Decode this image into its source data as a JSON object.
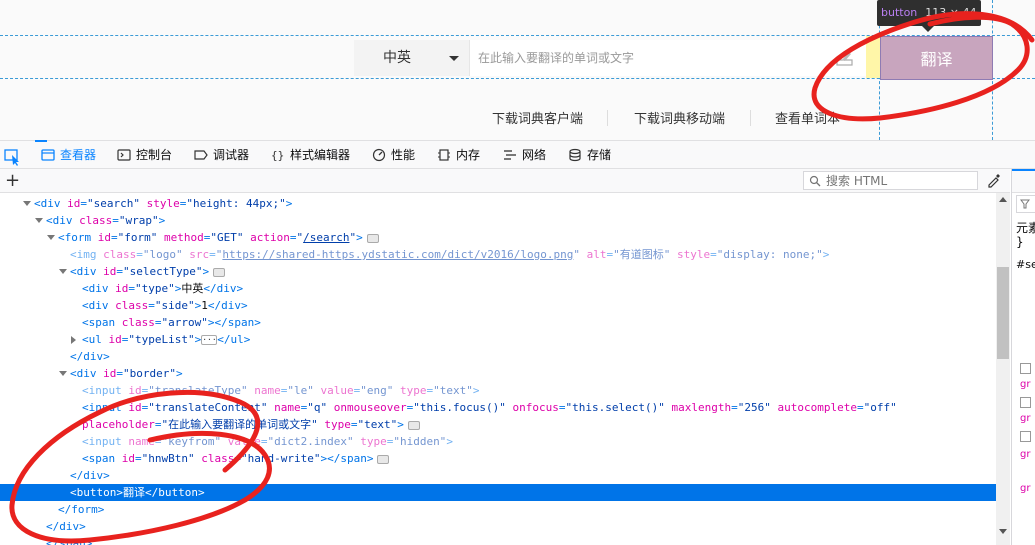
{
  "page": {
    "select_type_label": "中英",
    "search_placeholder": "在此输入要翻译的单词或文字",
    "translate_button_label": "翻译",
    "tooltip_tag": "button",
    "tooltip_dims": "113 × 44",
    "links": [
      "下载词典客户端",
      "下载词典移动端",
      "查看单词本"
    ]
  },
  "devtools": {
    "tabs": [
      {
        "label": "查看器",
        "icon": "inspector-icon",
        "active": true
      },
      {
        "label": "控制台",
        "icon": "console-icon",
        "active": false
      },
      {
        "label": "调试器",
        "icon": "debugger-icon",
        "active": false
      },
      {
        "label": "样式编辑器",
        "icon": "style-editor-icon",
        "active": false
      },
      {
        "label": "性能",
        "icon": "performance-icon",
        "active": false
      },
      {
        "label": "内存",
        "icon": "memory-icon",
        "active": false
      },
      {
        "label": "网络",
        "icon": "network-icon",
        "active": false
      },
      {
        "label": "存储",
        "icon": "storage-icon",
        "active": false
      }
    ],
    "search_html_placeholder": "搜索 HTML",
    "rules_panel": {
      "element_label": "元素",
      "brace": "}",
      "selector": "#se"
    }
  },
  "markup_lines": [
    {
      "indent": 0,
      "twisty": "open",
      "html": "<span class='tg'>&lt;div</span> <span class='an'>id</span>=<span class='av'>\"search\"</span> <span class='an'>style</span>=<span class='av'>\"height: 44px;\"</span><span class='tg'>&gt;</span>"
    },
    {
      "indent": 1,
      "twisty": "open",
      "html": "<span class='tg'>&lt;div</span> <span class='an'>class</span>=<span class='av'>\"wrap\"</span><span class='tg'>&gt;</span>"
    },
    {
      "indent": 2,
      "twisty": "open",
      "html": "<span class='tg'>&lt;form</span> <span class='an'>id</span>=<span class='av'>\"form\"</span> <span class='an'>method</span>=<span class='av'>\"GET\"</span> <span class='an'>action</span>=<span class='av'>\"<span class='url'>/search</span>\"</span><span class='tg'>&gt;</span><span class='ev'></span>"
    },
    {
      "indent": 3,
      "twisty": "none",
      "dim": true,
      "html": "<span class='tg'>&lt;img</span> <span class='an'>class</span>=<span class='av'>\"logo\"</span> <span class='an'>src</span>=<span class='av'>\"<span class='url'>https://shared-https.ydstatic.com/dict/v2016/logo.png</span>\"</span> <span class='an'>alt</span>=<span class='av'>\"有道图标\"</span> <span class='an'>style</span>=<span class='av'>\"display: none;\"</span><span class='tg'>&gt;</span>"
    },
    {
      "indent": 3,
      "twisty": "open",
      "html": "<span class='tg'>&lt;div</span> <span class='an'>id</span>=<span class='av'>\"selectType\"</span><span class='tg'>&gt;</span><span class='ev'></span>"
    },
    {
      "indent": 4,
      "twisty": "none",
      "html": "<span class='tg'>&lt;div</span> <span class='an'>id</span>=<span class='av'>\"type\"</span><span class='tg'>&gt;</span><span class='tx'>中英</span><span class='tg'>&lt;/div&gt;</span>"
    },
    {
      "indent": 4,
      "twisty": "none",
      "html": "<span class='tg'>&lt;div</span> <span class='an'>class</span>=<span class='av'>\"side\"</span><span class='tg'>&gt;</span><span class='tx'>1</span><span class='tg'>&lt;/div&gt;</span>"
    },
    {
      "indent": 4,
      "twisty": "none",
      "html": "<span class='tg'>&lt;span</span> <span class='an'>class</span>=<span class='av'>\"arrow\"</span><span class='tg'>&gt;&lt;/span&gt;</span>"
    },
    {
      "indent": 4,
      "twisty": "closed",
      "html": "<span class='tg'>&lt;ul</span> <span class='an'>id</span>=<span class='av'>\"typeList\"</span><span class='tg'>&gt;</span><span class='ellip'>···</span><span class='tg'>&lt;/ul&gt;</span>"
    },
    {
      "indent": 3,
      "twisty": "none",
      "html": "<span class='tg'>&lt;/div&gt;</span>"
    },
    {
      "indent": 3,
      "twisty": "open",
      "html": "<span class='tg'>&lt;div</span> <span class='an'>id</span>=<span class='av'>\"border\"</span><span class='tg'>&gt;</span>"
    },
    {
      "indent": 4,
      "twisty": "none",
      "dim": true,
      "html": "<span class='tg'>&lt;input</span> <span class='an'>id</span>=<span class='av'>\"translateType\"</span> <span class='an'>name</span>=<span class='av'>\"le\"</span> <span class='an'>value</span>=<span class='av'>\"eng\"</span> <span class='an'>type</span>=<span class='av'>\"text\"</span><span class='tg'>&gt;</span>"
    },
    {
      "indent": 4,
      "twisty": "none",
      "html": "<span class='tg'>&lt;input</span> <span class='an'>id</span>=<span class='av'>\"translateContent\"</span> <span class='an'>name</span>=<span class='av'>\"q\"</span> <span class='an'>onmouseover</span>=<span class='av'>\"this.focus()\"</span> <span class='an'>onfocus</span>=<span class='av'>\"this.select()\"</span> <span class='an'>maxlength</span>=<span class='av'>\"256\"</span> <span class='an'>autocomplete</span>=<span class='av'>\"off\"</span>"
    },
    {
      "indent": 4,
      "twisty": "none",
      "html": "<span class='an'>placeholder</span>=<span class='av'>\"在此输入要翻译的单词或文字\"</span> <span class='an'>type</span>=<span class='av'>\"text\"</span><span class='tg'>&gt;</span><span class='ev'></span>"
    },
    {
      "indent": 4,
      "twisty": "none",
      "dim": true,
      "html": "<span class='tg'>&lt;input</span> <span class='an'>name</span>=<span class='av'>\"keyfrom\"</span> <span class='an'>value</span>=<span class='av'>\"dict2.index\"</span> <span class='an'>type</span>=<span class='av'>\"hidden\"</span><span class='tg'>&gt;</span>"
    },
    {
      "indent": 4,
      "twisty": "none",
      "html": "<span class='tg'>&lt;span</span> <span class='an'>id</span>=<span class='av'>\"hnwBtn\"</span> <span class='an'>class</span>=<span class='av'>\"hand-write\"</span><span class='tg'>&gt;&lt;/span&gt;</span><span class='ev'></span>"
    },
    {
      "indent": 3,
      "twisty": "none",
      "html": "<span class='tg'>&lt;/div&gt;</span>"
    },
    {
      "indent": 3,
      "twisty": "none",
      "selected": true,
      "html": "<span class='tg'>&lt;button&gt;</span><span class='tx'>翻译</span><span class='tg'>&lt;/button&gt;</span>"
    },
    {
      "indent": 2,
      "twisty": "none",
      "html": "<span class='tg'>&lt;/form&gt;</span>"
    },
    {
      "indent": 1,
      "twisty": "none",
      "html": "<span class='tg'>&lt;/div&gt;</span>"
    },
    {
      "indent": 1,
      "twisty": "none",
      "html": "<span class='tg'>&lt;/span&gt;</span>"
    }
  ]
}
